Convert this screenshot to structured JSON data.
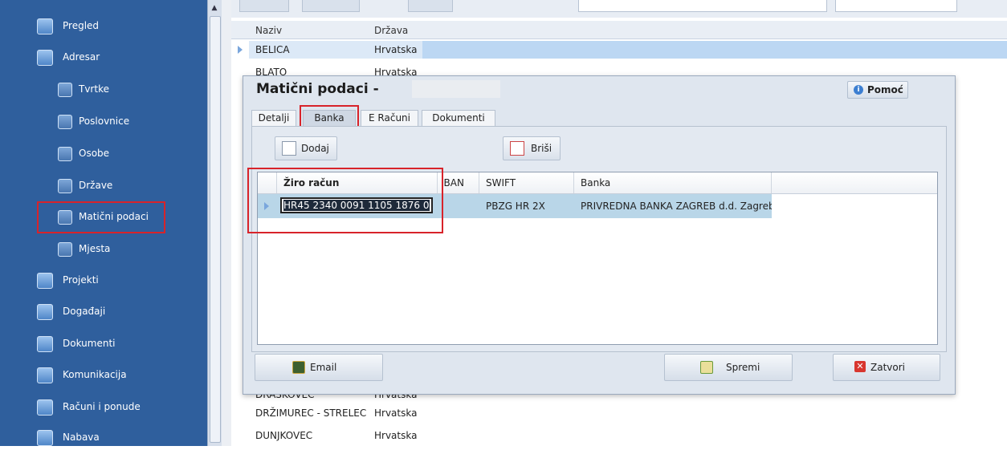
{
  "sidebar": {
    "items": [
      {
        "label": "Pregled"
      },
      {
        "label": "Adresar"
      },
      {
        "label": "Tvrtke"
      },
      {
        "label": "Poslovnice"
      },
      {
        "label": "Osobe"
      },
      {
        "label": "Države"
      },
      {
        "label": "Matični podaci"
      },
      {
        "label": "Mjesta"
      },
      {
        "label": "Projekti"
      },
      {
        "label": "Događaji"
      },
      {
        "label": "Dokumenti"
      },
      {
        "label": "Komunikacija"
      },
      {
        "label": "Računi i ponude"
      },
      {
        "label": "Nabava"
      }
    ]
  },
  "background_grid": {
    "headers": {
      "naziv": "Naziv",
      "drzava": "Država"
    },
    "rows": [
      {
        "naziv": "BELICA",
        "drzava": "Hrvatska"
      },
      {
        "naziv": "BLATO",
        "drzava": "Hrvatska"
      },
      {
        "naziv": "DRASKOVEC",
        "drzava": "Hrvatska"
      },
      {
        "naziv": "DRŽIMUREC - STRELEC",
        "drzava": "Hrvatska"
      },
      {
        "naziv": "DUNJKOVEC",
        "drzava": "Hrvatska"
      }
    ]
  },
  "dialog": {
    "title": "Matični podaci -",
    "help_label": "Pomoć",
    "tabs": [
      {
        "label": "Detalji"
      },
      {
        "label": "Banka"
      },
      {
        "label": "E Računi"
      },
      {
        "label": "Dokumenti"
      }
    ],
    "add_label": "Dodaj",
    "delete_label": "Briši",
    "grid": {
      "headers": {
        "ziro": "Žiro račun",
        "iban": "IBAN",
        "swift": "SWIFT",
        "banka": "Banka"
      },
      "row": {
        "ziro": "HR45 2340 0091 1105 1876 0",
        "iban": "",
        "swift": "PBZG HR 2X",
        "banka": "PRIVREDNA BANKA ZAGREB d.d. Zagreb"
      }
    },
    "email_label": "Email",
    "save_label": "Spremi",
    "close_label": "Zatvori"
  }
}
